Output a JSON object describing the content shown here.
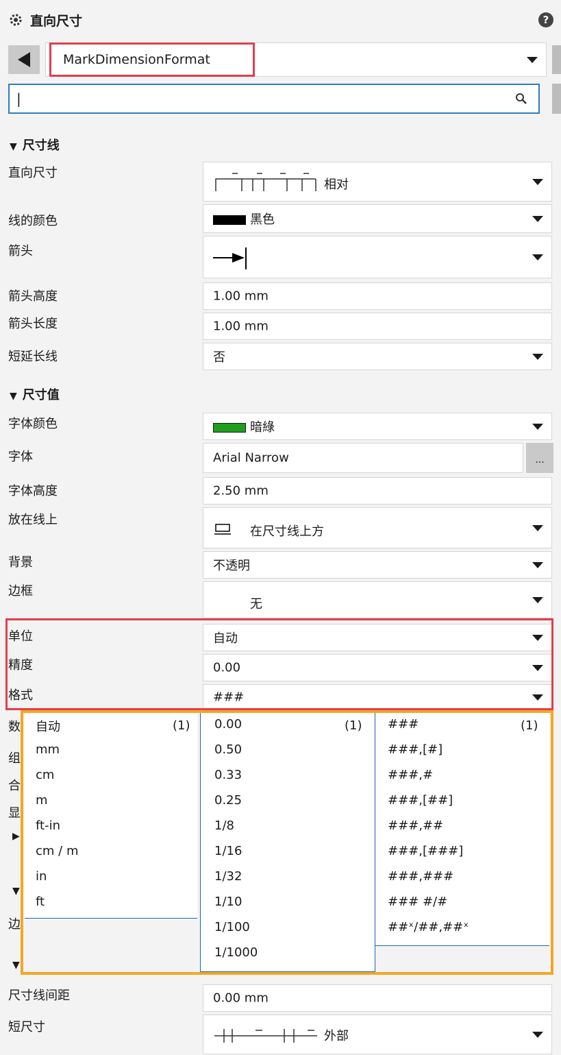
{
  "header": {
    "title": "直向尺寸",
    "help": "?"
  },
  "style_select": {
    "value": "MarkDimensionFormat"
  },
  "search": {
    "value": "|"
  },
  "sections": {
    "dim_line": "尺寸线",
    "dim_value": "尺寸值"
  },
  "props": {
    "direct_dim": {
      "label": "直向尺寸",
      "value": "相对"
    },
    "line_color": {
      "label": "线的颜色",
      "value": "黑色",
      "swatch": "#000000"
    },
    "arrow": {
      "label": "箭头"
    },
    "arrow_height": {
      "label": "箭头高度",
      "value": "1.00 mm"
    },
    "arrow_length": {
      "label": "箭头长度",
      "value": "1.00 mm"
    },
    "short_ext": {
      "label": "短延长线",
      "value": "否"
    },
    "font_color": {
      "label": "字体颜色",
      "value": "暗綠",
      "swatch": "#1f9e1f"
    },
    "font": {
      "label": "字体",
      "value": "Arial Narrow",
      "button": "..."
    },
    "font_height": {
      "label": "字体高度",
      "value": "2.50 mm"
    },
    "on_line": {
      "label": "放在线上",
      "value": "在尺寸线上方"
    },
    "background": {
      "label": "背景",
      "value": "不透明"
    },
    "border": {
      "label": "边框",
      "value": "无"
    },
    "unit": {
      "label": "单位",
      "value": "自动"
    },
    "precision": {
      "label": "精度",
      "value": "0.00"
    },
    "format": {
      "label": "格式",
      "value": "###"
    },
    "dim_spacing": {
      "label": "尺寸线间距",
      "value": "0.00 mm"
    },
    "short_dim": {
      "label": "短尺寸",
      "value": "外部"
    }
  },
  "hidden_labels": [
    "数",
    "组",
    "合",
    "显",
    "边"
  ],
  "dropdown": {
    "units": {
      "items": [
        "自动",
        "mm",
        "cm",
        "m",
        "ft-in",
        "cm / m",
        "in",
        "ft"
      ],
      "count": "(1)"
    },
    "precisions": {
      "items": [
        "0.00",
        "0.50",
        "0.33",
        "0.25",
        "1/8",
        "1/16",
        "1/32",
        "1/10",
        "1/100",
        "1/1000"
      ],
      "count": "(1)"
    },
    "formats": {
      "items": [
        "###",
        "###,[#]",
        "###,#",
        "###,[##]",
        "###,##",
        "###,[###]",
        "###,###",
        "### #/#",
        "##ˣ/##,##ˣ"
      ],
      "count": "(1)"
    }
  },
  "colors": {
    "highlight_red": "#e53c4d",
    "highlight_orange": "#f5a623",
    "list_border": "#1769aa"
  }
}
